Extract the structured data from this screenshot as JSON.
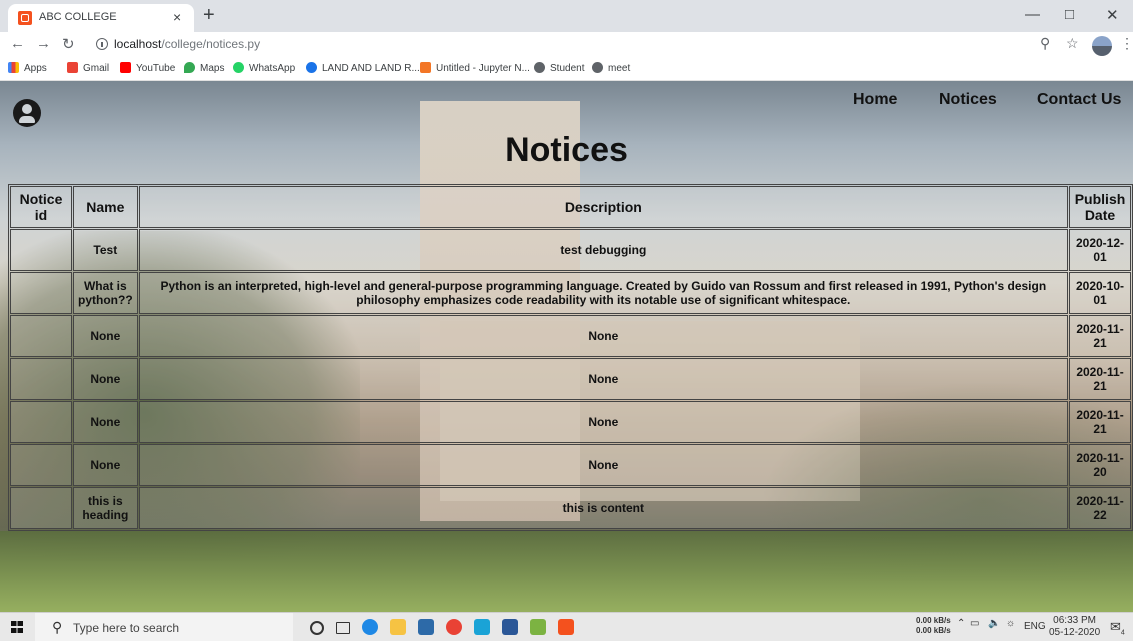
{
  "browser": {
    "tab_title": "ABC COLLEGE",
    "tab_close": "×",
    "new_tab": "+",
    "url_host": "localhost",
    "url_path": "/college/notices.py",
    "bookmarks": [
      "Apps",
      "Gmail",
      "YouTube",
      "Maps",
      "WhatsApp",
      "LAND AND LAND R...",
      "Untitled - Jupyter N...",
      "Student",
      "meet"
    ]
  },
  "nav": {
    "home": "Home",
    "notices": "Notices",
    "contact": "Contact Us"
  },
  "page_title": "Notices",
  "table": {
    "headers": {
      "id": "Notice id",
      "name": "Name",
      "description": "Description",
      "date": "Publish Date"
    },
    "rows": [
      {
        "name": "Test",
        "description": "test debugging",
        "date": "2020-12-01"
      },
      {
        "name": "What is python??",
        "description": "Python is an interpreted, high-level and general-purpose programming language. Created by Guido van Rossum and first released in 1991, Python's design philosophy emphasizes code readability with its notable use of significant whitespace.",
        "date": "2020-10-01"
      },
      {
        "name": "None",
        "description": "None",
        "date": "2020-11-21"
      },
      {
        "name": "None",
        "description": "None",
        "date": "2020-11-21"
      },
      {
        "name": "None",
        "description": "None",
        "date": "2020-11-21"
      },
      {
        "name": "None",
        "description": "None",
        "date": "2020-11-20"
      },
      {
        "name": "this is heading",
        "description": "this is content",
        "date": "2020-11-22"
      }
    ]
  },
  "taskbar": {
    "search_placeholder": "Type here to search",
    "net_up": "0.00 kB/s",
    "net_down": "0.00 kB/s",
    "lang": "ENG",
    "time": "06:33 PM",
    "date": "05-12-2020",
    "notif_count": "4"
  }
}
